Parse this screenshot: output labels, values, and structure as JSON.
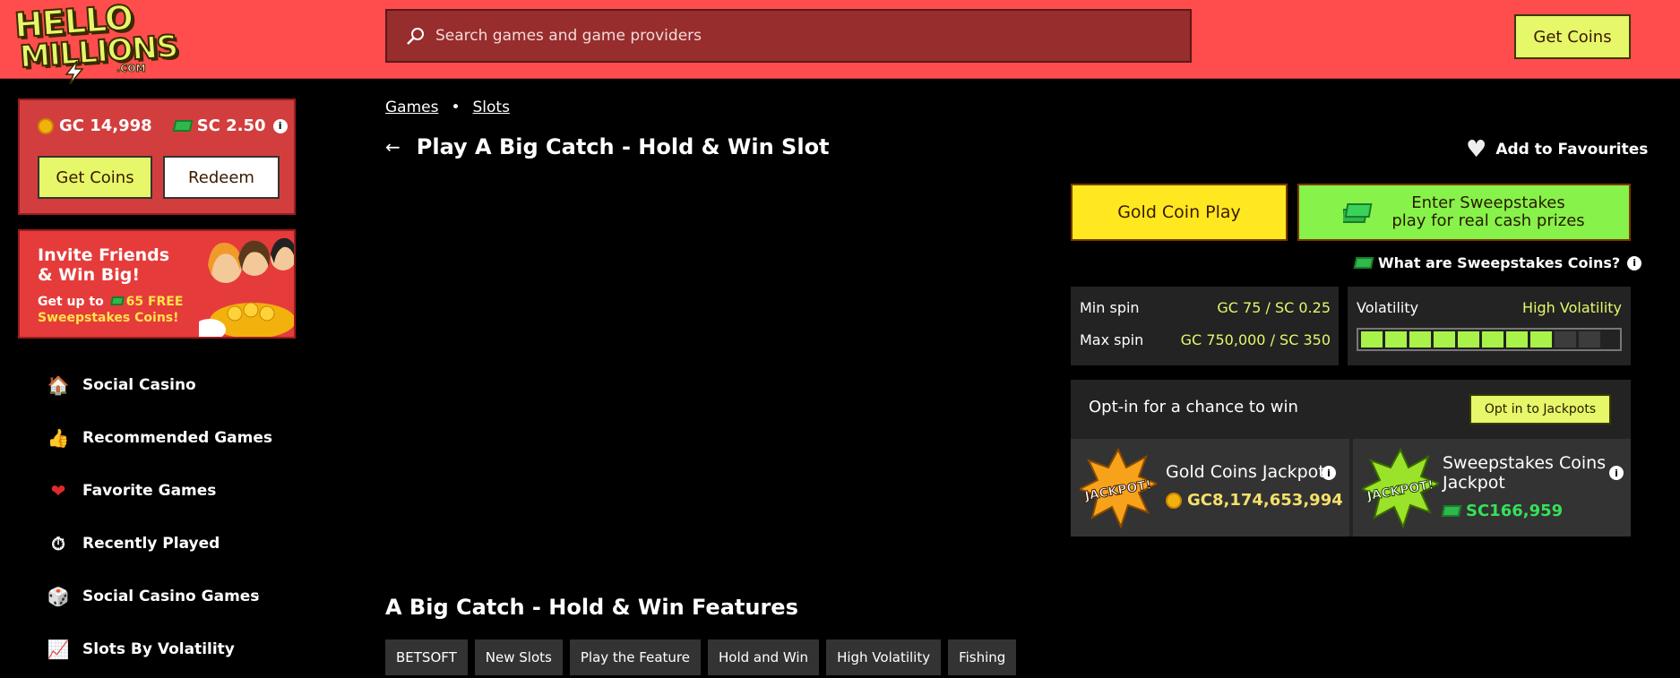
{
  "header": {
    "logo_line1": "HELLO",
    "logo_line2": "MILLIONS",
    "logo_line3": ".COM",
    "search_placeholder": "Search games and game providers",
    "get_coins": "Get Coins"
  },
  "balance": {
    "gc": "GC 14,998",
    "sc": "SC 2.50",
    "get_coins": "Get Coins",
    "redeem": "Redeem"
  },
  "promo": {
    "title": "Invite Friends & Win Big!",
    "sub_prefix": "Get up to",
    "sub_highlight": "65 FREE",
    "sub_suffix": "Sweepstakes Coins!"
  },
  "sidebar": {
    "items": [
      {
        "label": "Social Casino",
        "icon": "house-icon"
      },
      {
        "label": "Recommended Games",
        "icon": "thumbs-up-icon"
      },
      {
        "label": "Favorite Games",
        "icon": "heart-icon"
      },
      {
        "label": "Recently Played",
        "icon": "stopwatch-icon"
      },
      {
        "label": "Social Casino Games",
        "icon": "dice-icon"
      },
      {
        "label": "Slots By Volatility",
        "icon": "chart-icon"
      }
    ]
  },
  "breadcrumb": {
    "games": "Games",
    "slots": "Slots"
  },
  "page_title": "Play A Big Catch - Hold & Win Slot",
  "favourites": "Add to Favourites",
  "play": {
    "gold": "Gold Coin Play",
    "sweep_line1": "Enter Sweepstakes",
    "sweep_line2": "play for real cash prizes",
    "what": "What are Sweepstakes Coins?"
  },
  "stats": {
    "min_label": "Min spin",
    "min_value": "GC 75 / SC 0.25",
    "max_label": "Max spin",
    "max_value": "GC 750,000 / SC 350",
    "vol_label": "Volatility",
    "vol_value": "High Volatility",
    "vol_level": 8,
    "vol_total": 10
  },
  "jackpots": {
    "heading": "Opt-in for a chance to win",
    "opt_in": "Opt in to Jackpots",
    "gold_name": "Gold Coins Jackpot",
    "gold_value": "GC8,174,653,994",
    "sweep_name_1": "Sweepstakes Coins",
    "sweep_name_2": "Jackpot",
    "sweep_value": "SC166,959",
    "burst_text": "JACKPOT!"
  },
  "features": {
    "title": "A Big Catch - Hold & Win Features",
    "tags": [
      "BETSOFT",
      "New Slots",
      "Play the Feature",
      "Hold and Win",
      "High Volatility",
      "Fishing"
    ]
  },
  "colors": {
    "header": "#ff4d4d",
    "accent_yellow": "#e6f76a",
    "gold_button": "#ffe81f",
    "sweep_button": "#87f24a",
    "sc_green": "#36e05a"
  }
}
